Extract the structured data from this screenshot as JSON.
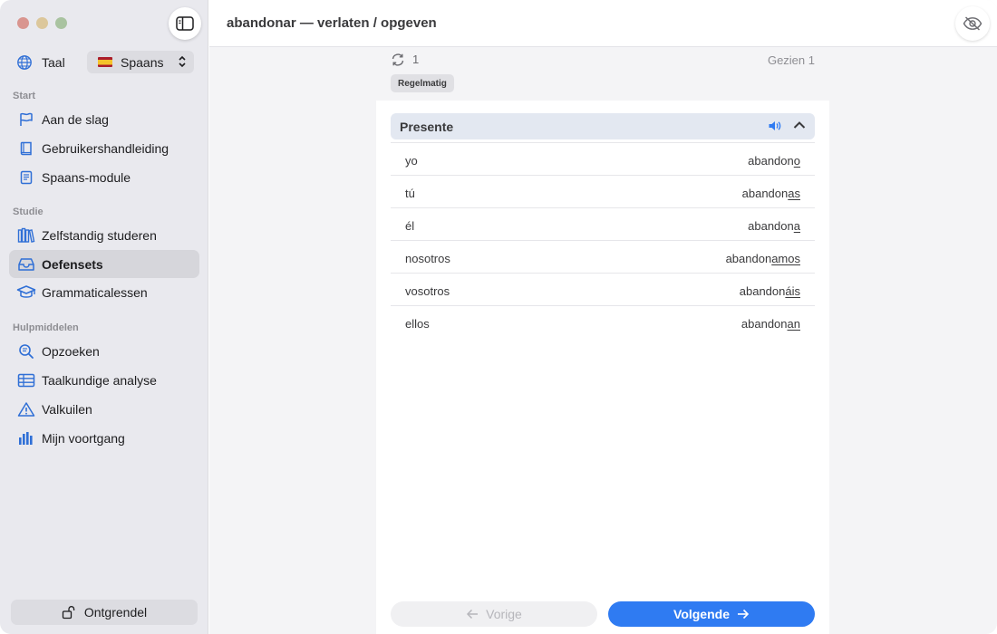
{
  "window": {
    "title": "abandonar — verlaten / opgeven"
  },
  "sidebar": {
    "language_label": "Taal",
    "language_value": "Spaans",
    "sections": [
      {
        "heading": "Start",
        "items": [
          {
            "label": "Aan de slag",
            "icon": "flag-icon"
          },
          {
            "label": "Gebruikershandleiding",
            "icon": "book-icon"
          },
          {
            "label": "Spaans-module",
            "icon": "module-book-icon"
          }
        ]
      },
      {
        "heading": "Studie",
        "items": [
          {
            "label": "Zelfstandig studeren",
            "icon": "library-icon"
          },
          {
            "label": "Oefensets",
            "icon": "tray-icon",
            "active": true
          },
          {
            "label": "Grammaticalessen",
            "icon": "graduation-cap-icon"
          }
        ]
      },
      {
        "heading": "Hulpmiddelen",
        "items": [
          {
            "label": "Opzoeken",
            "icon": "search-icon"
          },
          {
            "label": "Taalkundige analyse",
            "icon": "table-icon"
          },
          {
            "label": "Valkuilen",
            "icon": "warning-icon"
          },
          {
            "label": "Mijn voortgang",
            "icon": "bar-chart-icon"
          }
        ]
      }
    ],
    "unlock_label": "Ontgrendel"
  },
  "main": {
    "review_count": "1",
    "seen_label": "Gezien 1",
    "tag": "Regelmatig",
    "tense": {
      "title": "Presente",
      "rows": [
        {
          "pronoun": "yo",
          "stem": "abandon",
          "ending": "o"
        },
        {
          "pronoun": "tú",
          "stem": "abandon",
          "ending": "as"
        },
        {
          "pronoun": "él",
          "stem": "abandon",
          "ending": "a"
        },
        {
          "pronoun": "nosotros",
          "stem": "abandon",
          "ending": "amos"
        },
        {
          "pronoun": "vosotros",
          "stem": "abandon",
          "ending": "áis"
        },
        {
          "pronoun": "ellos",
          "stem": "abandon",
          "ending": "an"
        }
      ]
    },
    "prev_label": "Vorige",
    "next_label": "Volgende"
  },
  "colors": {
    "accent": "#2f7bf2",
    "sidebar_bg": "#e9e9ee",
    "tense_header_bg": "#e3e8f1"
  }
}
